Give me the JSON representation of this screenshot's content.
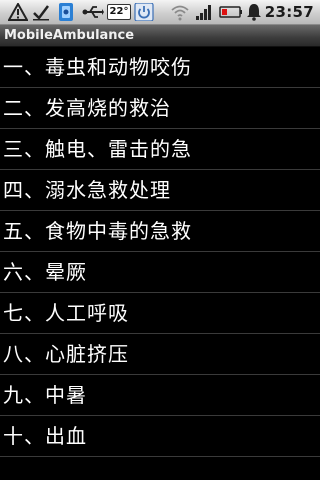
{
  "status_bar": {
    "icons": [
      "warning-icon",
      "check-icon",
      "usb-debug-icon",
      "usb-icon",
      "temperature-icon",
      "power-icon",
      "wifi-icon",
      "signal-icon",
      "battery-icon",
      "notification-icon"
    ],
    "temperature": "22°",
    "time": "23:57"
  },
  "title_bar": {
    "title": "MobileAmbulance"
  },
  "list": {
    "items": [
      {
        "label": "一、毒虫和动物咬伤"
      },
      {
        "label": "二、发高烧的救治"
      },
      {
        "label": "三、触电、雷击的急"
      },
      {
        "label": "四、溺水急救处理"
      },
      {
        "label": "五、食物中毒的急救"
      },
      {
        "label": "六、晕厥"
      },
      {
        "label": "七、人工呼吸"
      },
      {
        "label": "八、心脏挤压"
      },
      {
        "label": "九、中暑"
      },
      {
        "label": "十、出血"
      }
    ]
  },
  "colors": {
    "background": "#000000",
    "text": "#ffffff",
    "divider": "#3a3a3a",
    "usb_debug_accent": "#2a7fd4"
  }
}
